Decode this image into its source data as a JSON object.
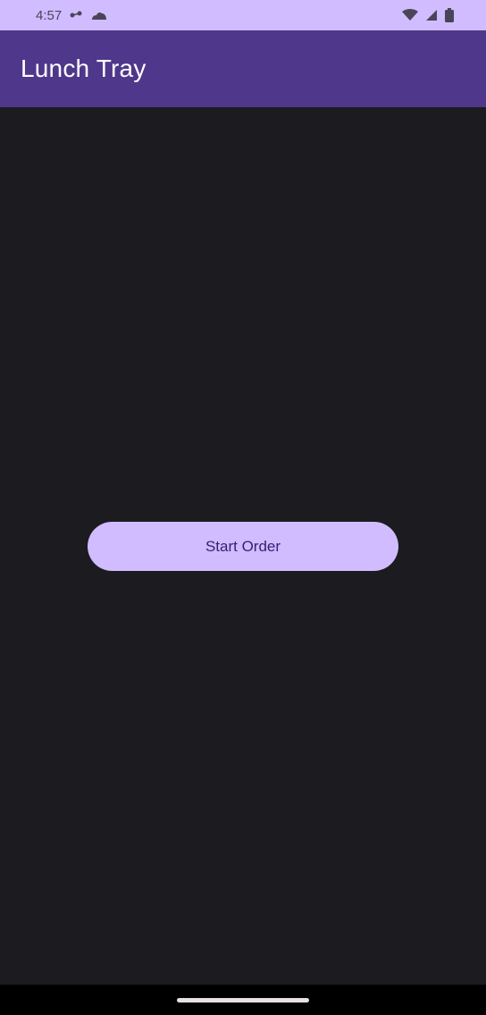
{
  "status_bar": {
    "time": "4:57",
    "left_icons": [
      "signal-indicator-icon",
      "cloud-icon"
    ],
    "right_icons": [
      "wifi-icon",
      "cellular-signal-icon",
      "battery-icon"
    ]
  },
  "app_bar": {
    "title": "Lunch Tray"
  },
  "main": {
    "start_button_label": "Start Order"
  },
  "colors": {
    "status_bar_bg": "#d0bcff",
    "app_bar_bg": "#4f378b",
    "background": "#1c1b1f",
    "button_bg": "#d0bcff",
    "button_text": "#381e72"
  }
}
